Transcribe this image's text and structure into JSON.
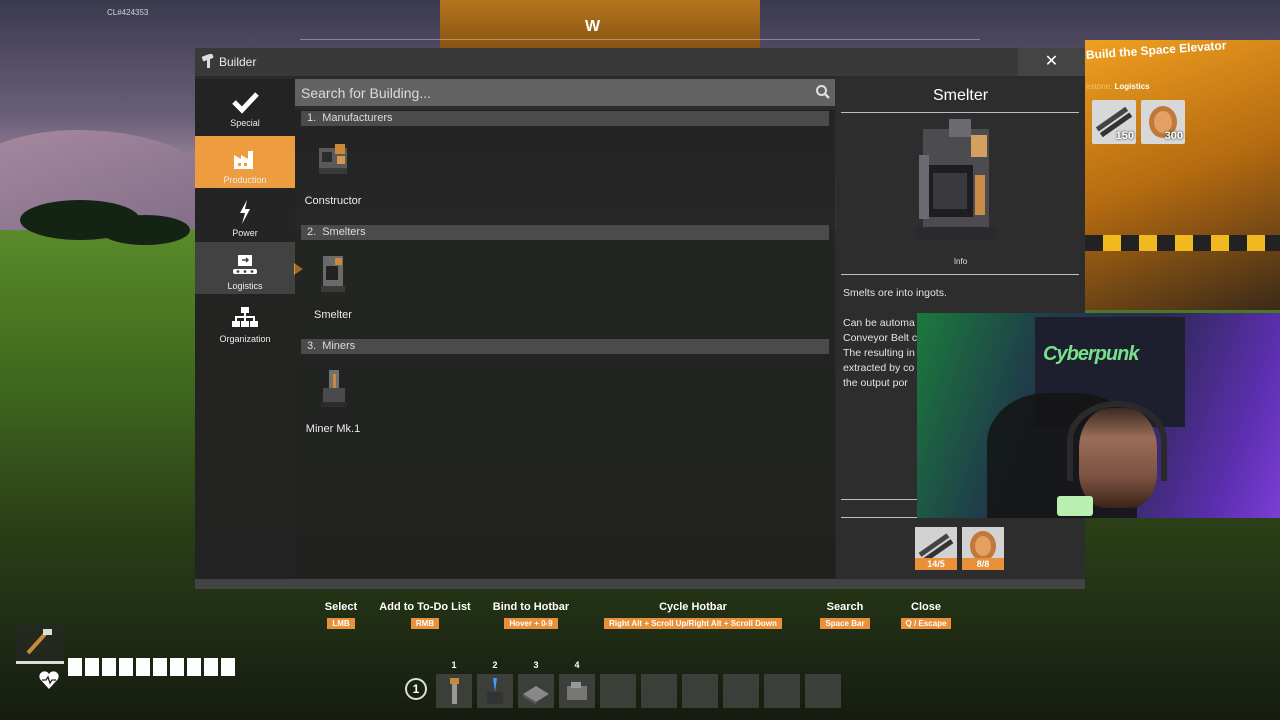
{
  "hud": {
    "cl_id": "CL#424353",
    "compass_direction": "W",
    "objective_title": "Build the Space Elevator",
    "objective_milestone_prefix": "estone:",
    "objective_milestone_name": "Logistics",
    "objective_items": [
      {
        "icon": "iron-rod-icon",
        "count": "150"
      },
      {
        "icon": "copper-wire-icon",
        "count": "300"
      }
    ],
    "health_segments": 10,
    "hotbar_page": "1",
    "hotbar_numbers": [
      "1",
      "2",
      "3",
      "4"
    ],
    "hotbar_slots": 10
  },
  "builder": {
    "title": "Builder",
    "close_label": "✕",
    "search_placeholder": "Search for Building...",
    "categories": [
      {
        "label": "Special",
        "icon": "checkmark-icon",
        "state": "normal"
      },
      {
        "label": "Production",
        "icon": "factory-icon",
        "state": "active"
      },
      {
        "label": "Power",
        "icon": "lightning-icon",
        "state": "normal"
      },
      {
        "label": "Logistics",
        "icon": "logistics-icon",
        "state": "hovered"
      },
      {
        "label": "Organization",
        "icon": "hierarchy-icon",
        "state": "normal"
      }
    ],
    "sections": [
      {
        "num": "1.",
        "name": "Manufacturers",
        "buildings": [
          "Constructor"
        ]
      },
      {
        "num": "2.",
        "name": "Smelters",
        "buildings": [
          "Smelter"
        ]
      },
      {
        "num": "3.",
        "name": "Miners",
        "buildings": [
          "Miner Mk.1"
        ]
      }
    ],
    "details": {
      "title": "Smelter",
      "info_label": "Info",
      "description_line1": "Smelts ore into ingots.",
      "description_rest": "Can be automa\nConveyor Belt c\nThe resulting in\nextracted by co\nthe output por",
      "costs": [
        {
          "icon": "iron-rod-icon",
          "count": "14/5"
        },
        {
          "icon": "copper-wire-icon",
          "count": "8/8"
        }
      ]
    }
  },
  "controls": [
    {
      "label": "Select",
      "key": "LMB"
    },
    {
      "label": "Add to To-Do List",
      "key": "RMB"
    },
    {
      "label": "Bind to Hotbar",
      "key": "Hover + 0-9"
    },
    {
      "label": "Cycle Hotbar",
      "key": "Right Alt + Scroll Up/Right Alt + Scroll Down"
    },
    {
      "label": "Search",
      "key": "Space Bar"
    },
    {
      "label": "Close",
      "key": "Q / Escape"
    }
  ],
  "webcam": {
    "poster_text": "Cyberpunk"
  },
  "colors": {
    "accent": "#e9913a",
    "panel": "#282828",
    "section_header": "#4b4b4b"
  }
}
